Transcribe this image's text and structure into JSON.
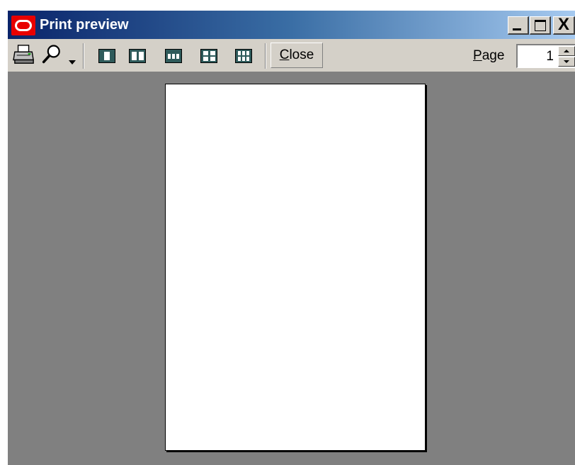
{
  "window": {
    "title": "Print preview",
    "app_icon": "oracle-logo-icon",
    "caption_buttons": {
      "minimize": "minimize-icon",
      "maximize": "maximize-icon",
      "close": "close-icon",
      "close_glyph": "X"
    }
  },
  "toolbar": {
    "print_icon": "printer-icon",
    "zoom_icon": "magnifier-icon",
    "zoom_dropdown_icon": "chevron-down-icon",
    "layouts": [
      {
        "name": "one-page-icon"
      },
      {
        "name": "two-pages-icon"
      },
      {
        "name": "three-pages-icon"
      },
      {
        "name": "four-pages-icon"
      },
      {
        "name": "six-pages-icon"
      }
    ],
    "close_label_mnemonic": "C",
    "close_label_rest": "lose",
    "page_label_mnemonic": "P",
    "page_label_rest": "age",
    "page_value": "1"
  },
  "colors": {
    "titlebar_start": "#0a246a",
    "titlebar_end": "#a6caf0",
    "chrome": "#d4d0c8",
    "canvas": "#808080",
    "page": "#ffffff",
    "app_icon": "#e80000"
  }
}
